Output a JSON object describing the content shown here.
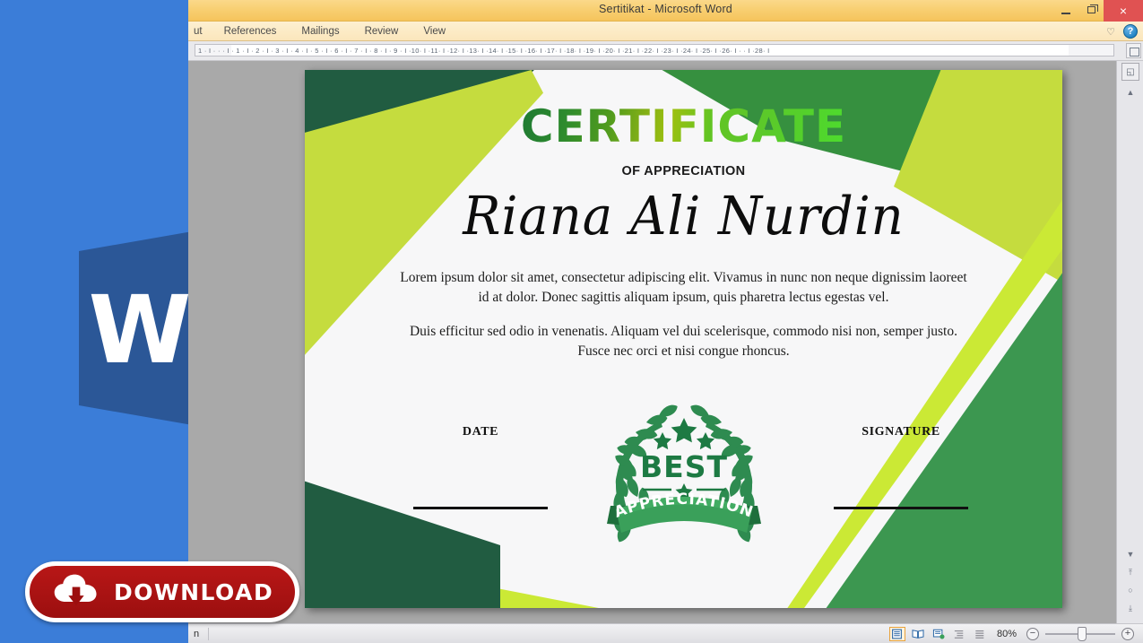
{
  "window": {
    "title": "Sertitikat  -  Microsoft Word",
    "minimize_label": "Minimize",
    "restore_label": "Restore Down",
    "close_label": "×"
  },
  "ribbon": {
    "tabs": [
      {
        "label": "ut",
        "clipped": true
      },
      {
        "label": "References"
      },
      {
        "label": "Mailings"
      },
      {
        "label": "Review"
      },
      {
        "label": "View"
      }
    ],
    "collapse_icon": "♡",
    "help_icon": "?"
  },
  "ruler": {
    "ticks": "1 · I · ·  · I · 1 · I · 2 · I · 3 · I · 4 · I · 5 · I · 6 · I · 7 · I · 8 · I · 9 · I ·10· I ·11· I ·12· I ·13· I ·14· I ·15· I ·16· I ·17· I ·18· I ·19· I ·20· I ·21· I ·22· I ·23· I ·24· I ·25· I ·26· I ·  · I ·28· I",
    "corner_icon": "page-setup-icon"
  },
  "certificate": {
    "title": "CERTIFICATE",
    "subtitle": "OF APPRECIATION",
    "recipient": "Riana Ali Nurdin",
    "paragraphs": [
      "Lorem ipsum dolor sit amet, consectetur adipiscing elit. Vivamus in nunc non neque dignissim laoreet id at dolor. Donec sagittis aliquam ipsum, quis pharetra lectus egestas vel.",
      "Duis efficitur sed odio in venenatis. Aliquam vel dui scelerisque, commodo nisi non, semper justo. Fusce nec orci et nisi congue rhoncus."
    ],
    "date_label": "DATE",
    "signature_label": "SIGNATURE",
    "badge": {
      "top_text": "BEST",
      "ribbon_text": "APPRECIATION"
    },
    "colors": {
      "dark_green": "#215c41",
      "medium_green": "#3c9750",
      "lime": "#c5dc3e",
      "bright_lime": "#cbe935",
      "paper": "#f7f7f8"
    }
  },
  "statusbar": {
    "left_text": "n",
    "zoom_level": "80%",
    "zoom_out_icon": "−",
    "zoom_in_icon": "+",
    "views": [
      {
        "name": "print-layout-view",
        "active": true
      },
      {
        "name": "read-mode-view",
        "active": false
      },
      {
        "name": "web-layout-view",
        "active": false
      },
      {
        "name": "outline-view",
        "active": false
      },
      {
        "name": "draft-view",
        "active": false
      }
    ]
  },
  "scrollbar": {
    "up_icon": "▲",
    "down_icon": "▼",
    "previous_icon": "⤒",
    "select_object_icon": "○",
    "next_icon": "⤓",
    "object_icon": "◱"
  },
  "overlay": {
    "download_label": "DOWNLOAD",
    "download_icon": "cloud-download-icon",
    "app_logo": "microsoft-word-logo",
    "download_color": "#a81212"
  }
}
